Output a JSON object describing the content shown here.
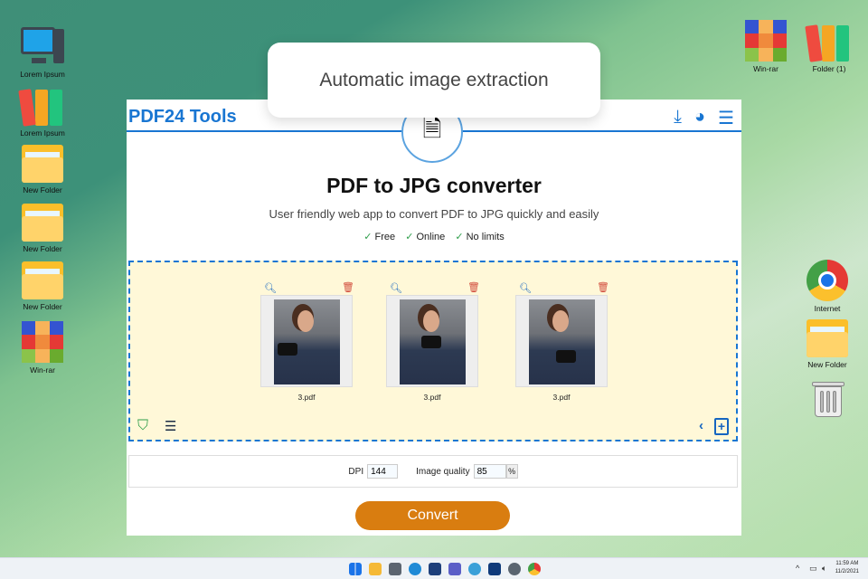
{
  "desktop": {
    "left_icons": [
      {
        "label": "Lorem Ipsum",
        "icon": "computer-icon"
      },
      {
        "label": "Lorem Ipsum",
        "icon": "binders-icon"
      },
      {
        "label": "New Folder",
        "icon": "folder-icon"
      },
      {
        "label": "New Folder",
        "icon": "folder-icon"
      },
      {
        "label": "New Folder",
        "icon": "folder-icon"
      },
      {
        "label": "Win-rar",
        "icon": "winrar-icon"
      }
    ],
    "right_icons": [
      {
        "label": "Win-rar",
        "icon": "winrar-icon"
      },
      {
        "label": "Folder (1)",
        "icon": "binders-icon"
      },
      {
        "label": "Internet",
        "icon": "chrome-icon"
      },
      {
        "label": "New Folder",
        "icon": "folder-icon"
      },
      {
        "label": "",
        "icon": "recycle-bin-icon"
      }
    ]
  },
  "tooltip": "Automatic image extraction",
  "app": {
    "brand": "PDF24 Tools",
    "title": "PDF to JPG converter",
    "subtitle": "User friendly web app to convert PDF to JPG quickly and easily",
    "features": [
      "Free",
      "Online",
      "No limits"
    ],
    "check": "✓",
    "files": [
      {
        "name": "3.pdf"
      },
      {
        "name": "3.pdf"
      },
      {
        "name": "3.pdf"
      }
    ],
    "options": {
      "dpi_label": "DPI",
      "dpi_value": "144",
      "quality_label": "Image quality",
      "quality_value": "85",
      "quality_unit": "%"
    },
    "convert_label": "Convert",
    "accent": "#1976d2",
    "button_color": "#d97d10"
  },
  "taskbar": {
    "time": "11:59 AM",
    "date": "11/2/2021"
  }
}
